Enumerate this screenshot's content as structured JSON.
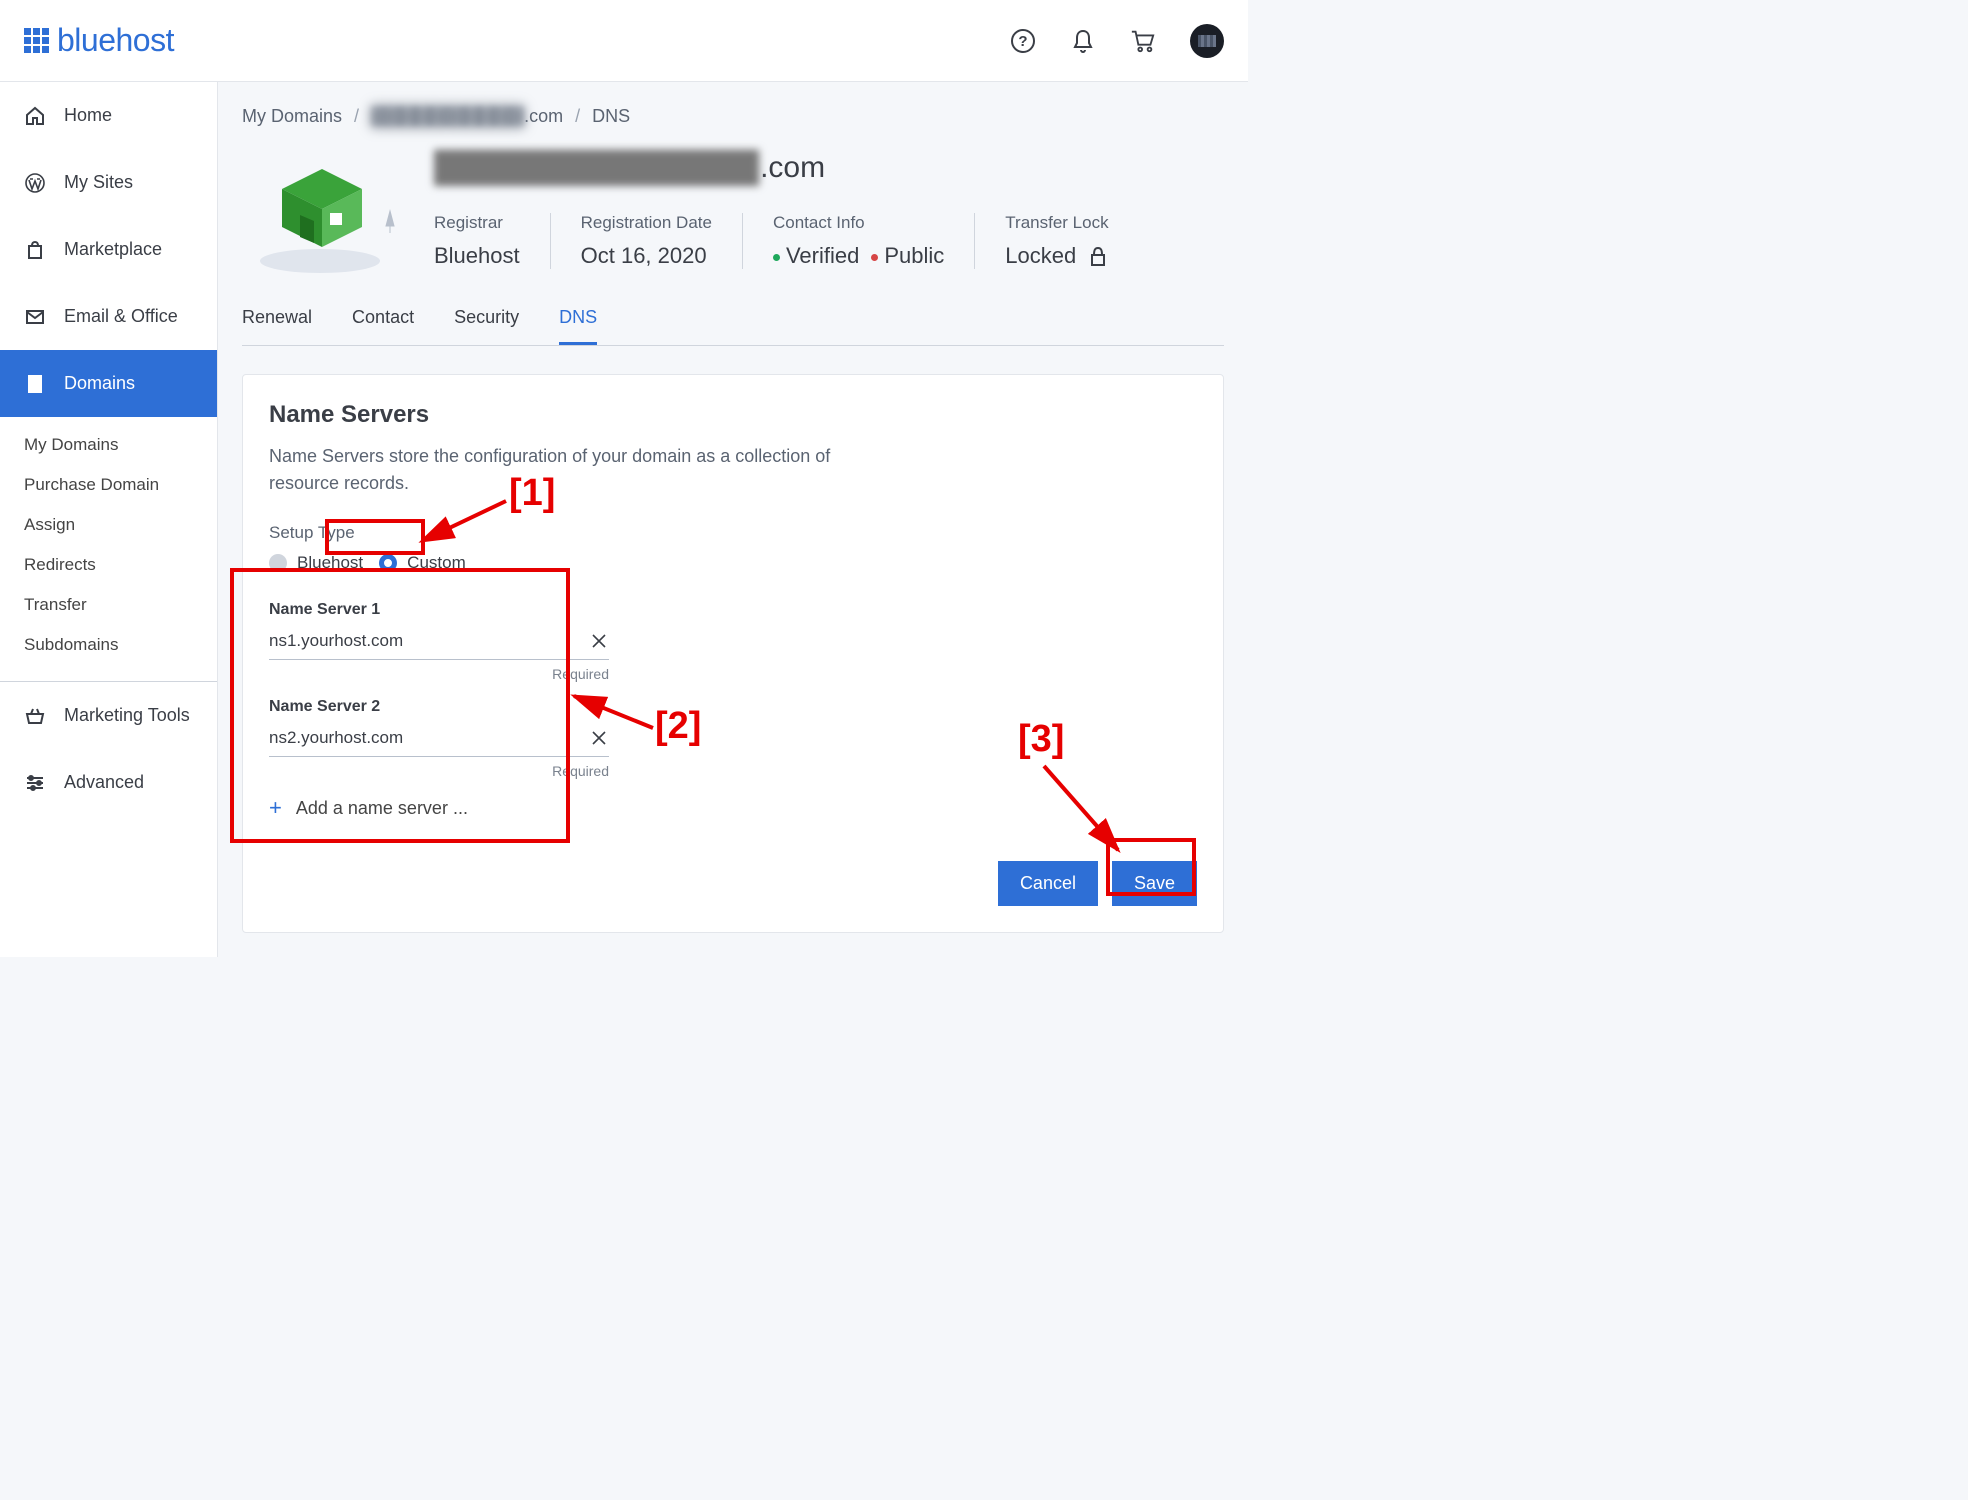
{
  "brand": "bluehost",
  "topbar": {
    "help": "?",
    "notifications": "",
    "cart": ""
  },
  "sidebar": {
    "items": [
      {
        "icon": "home",
        "label": "Home"
      },
      {
        "icon": "wordpress",
        "label": "My Sites"
      },
      {
        "icon": "bag",
        "label": "Marketplace"
      },
      {
        "icon": "mail",
        "label": "Email & Office"
      },
      {
        "icon": "building",
        "label": "Domains",
        "active": true
      },
      {
        "icon": "basket",
        "label": "Marketing Tools"
      },
      {
        "icon": "sliders",
        "label": "Advanced"
      }
    ],
    "sub": [
      "My Domains",
      "Purchase Domain",
      "Assign",
      "Redirects",
      "Transfer",
      "Subdomains"
    ]
  },
  "breadcrumb": {
    "root": "My Domains",
    "domain_obscured": "████████████",
    "domain_tld": ".com",
    "leaf": "DNS"
  },
  "domain": {
    "title_obscured": "████████████████",
    "title_tld": ".com",
    "meta": {
      "registrar_label": "Registrar",
      "registrar_value": "Bluehost",
      "regdate_label": "Registration Date",
      "regdate_value": "Oct 16, 2020",
      "contact_label": "Contact Info",
      "contact_verified": "Verified",
      "contact_public": "Public",
      "transfer_label": "Transfer Lock",
      "transfer_value": "Locked"
    }
  },
  "tabs": [
    {
      "label": "Renewal"
    },
    {
      "label": "Contact"
    },
    {
      "label": "Security"
    },
    {
      "label": "DNS",
      "active": true
    }
  ],
  "card": {
    "title": "Name Servers",
    "desc": "Name Servers store the configuration of your domain as a collection of resource records.",
    "setup_label": "Setup Type",
    "radio_bluehost": "Bluehost",
    "radio_custom": "Custom",
    "ns1_label": "Name Server 1",
    "ns1_value": "ns1.yourhost.com",
    "ns1_hint": "Required",
    "ns2_label": "Name Server 2",
    "ns2_value": "ns2.yourhost.com",
    "ns2_hint": "Required",
    "add_label": "Add a name server ...",
    "cancel": "Cancel",
    "save": "Save"
  },
  "annotations": {
    "a1": "[1]",
    "a2": "[2]",
    "a3": "[3]"
  }
}
